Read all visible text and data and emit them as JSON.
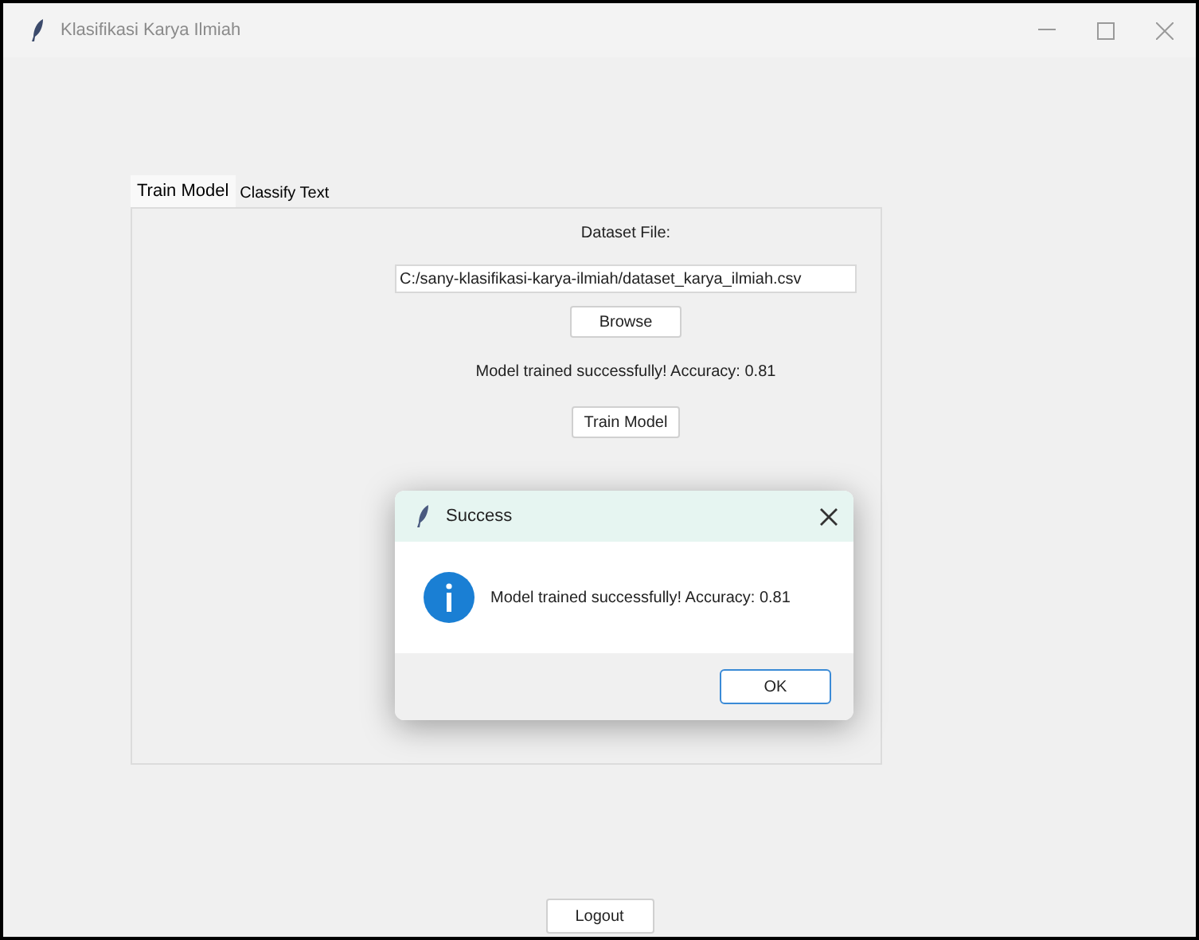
{
  "window": {
    "title": "Klasifikasi Karya Ilmiah"
  },
  "tabs": [
    {
      "label": "Train Model",
      "selected": true
    },
    {
      "label": "Classify Text",
      "selected": false
    }
  ],
  "train": {
    "dataset_label": "Dataset File:",
    "dataset_path": "C:/sany-klasifikasi-karya-ilmiah/dataset_karya_ilmiah.csv",
    "browse": "Browse",
    "status": "Model trained successfully! Accuracy: 0.81",
    "train_button": "Train Model"
  },
  "dialog": {
    "title": "Success",
    "message": "Model trained successfully! Accuracy: 0.81",
    "ok": "OK"
  },
  "logout": "Logout"
}
